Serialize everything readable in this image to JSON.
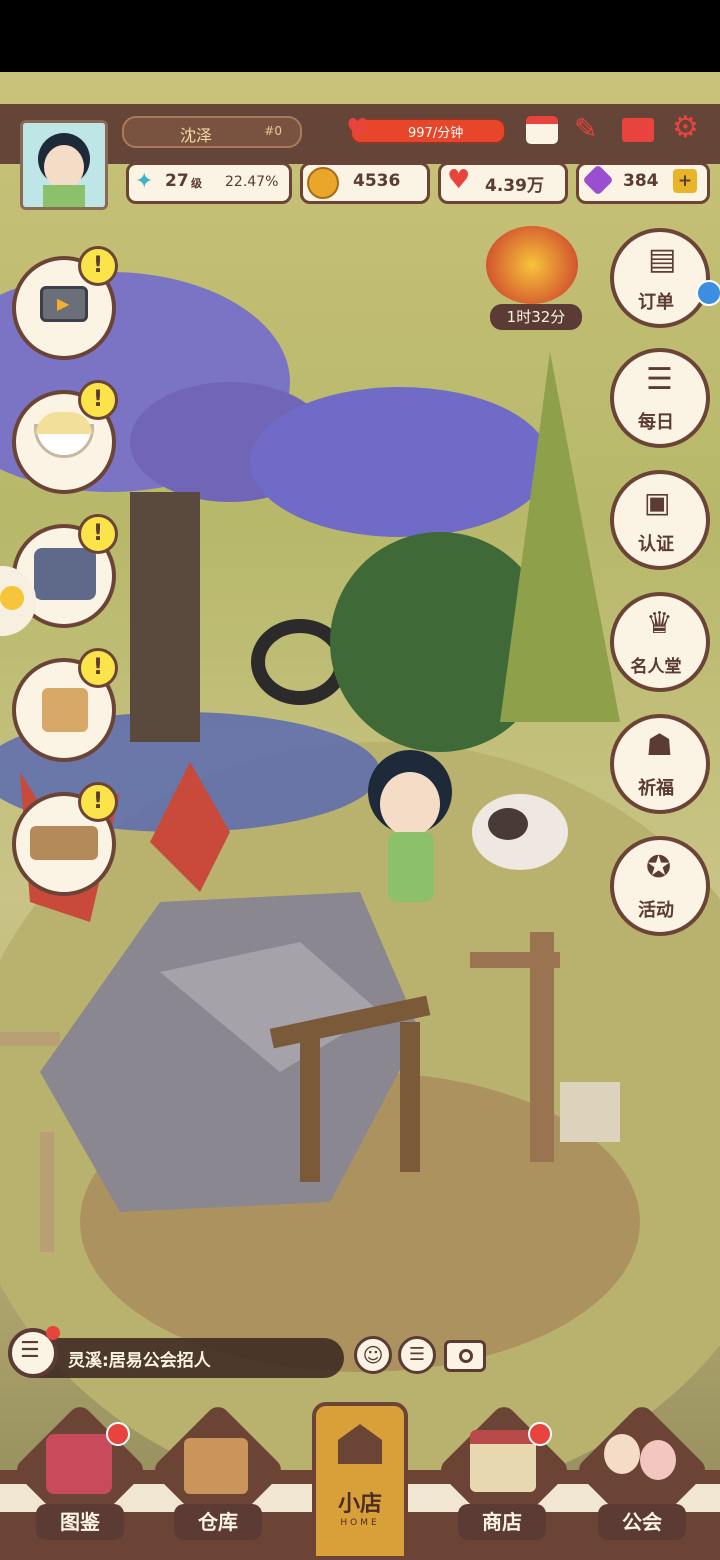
{
  "colors": {
    "hud_brown": "#5b3b33",
    "accent_red": "#e8433c",
    "cream": "#fbf3e4",
    "alert_yellow": "#fbe44a"
  },
  "player": {
    "name": "沈泽",
    "id": "#0",
    "level": "27",
    "level_unit": "级",
    "exp_percent": "22.47%"
  },
  "resources": {
    "energy_rate": "997/分钟",
    "coins": "4536",
    "hearts": "4.39万",
    "gems": "384",
    "add": "+"
  },
  "top_icons": [
    "calendar-icon",
    "broom-icon",
    "mail-icon",
    "settings-icon"
  ],
  "event": {
    "timer": "1时32分"
  },
  "right_menu": [
    {
      "name": "orders",
      "label": "订单"
    },
    {
      "name": "daily",
      "label": "每日"
    },
    {
      "name": "certify",
      "label": "认证"
    },
    {
      "name": "hall-of-fame",
      "label": "名人堂"
    },
    {
      "name": "pray",
      "label": "祈福"
    },
    {
      "name": "events",
      "label": "活动"
    }
  ],
  "left_menu": [
    {
      "name": "tv",
      "alert": "!"
    },
    {
      "name": "rice-bowl",
      "alert": "!"
    },
    {
      "name": "machine",
      "alert": "!"
    },
    {
      "name": "basket",
      "alert": "!"
    },
    {
      "name": "bathtub",
      "alert": "!"
    }
  ],
  "chat": {
    "message": "灵溪:居易公会招人"
  },
  "bottom_nav": [
    {
      "name": "collection",
      "label": "图鉴"
    },
    {
      "name": "warehouse",
      "label": "仓库"
    },
    {
      "name": "shop-home",
      "label": "小店",
      "sub": "HOME"
    },
    {
      "name": "store",
      "label": "商店"
    },
    {
      "name": "guild",
      "label": "公会"
    }
  ]
}
